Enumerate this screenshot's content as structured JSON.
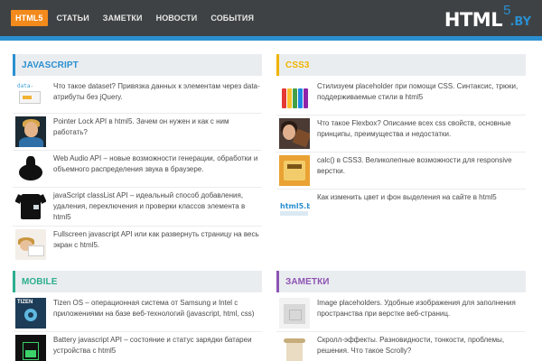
{
  "header": {
    "nav": [
      {
        "label": "HTML5",
        "active": true
      },
      {
        "label": "СТАТЬИ",
        "active": false
      },
      {
        "label": "ЗАМЕТКИ",
        "active": false
      },
      {
        "label": "НОВОСТИ",
        "active": false
      },
      {
        "label": "СОБЫТИЯ",
        "active": false
      }
    ],
    "logo": {
      "main": "HTML",
      "five": "5",
      "by": ".BY"
    }
  },
  "sections": {
    "javascript": {
      "title": "JAVASCRIPT",
      "accent": "#2a8fd0",
      "articles": [
        {
          "text": "Что такое dataset? Привязка данных к элементам через data-атрибуты без jQuery.",
          "thumb_label": "data-"
        },
        {
          "text": "Pointer Lock API в html5. Зачем он нужен и как с ним работать?"
        },
        {
          "text": "Web Audio API – новые возможности генерации, обработки и объемного распределения звука в браузере."
        },
        {
          "text": "javaScript classList API – идеальный способ добавления, удаления, переключения и проверки классов элемента в html5"
        },
        {
          "text": "Fullscreen javascript API или как развернуть страницу на весь экран с html5."
        }
      ]
    },
    "css3": {
      "title": "CSS3",
      "accent": "#f0b400",
      "articles": [
        {
          "text": "Стилизуем placeholder при помощи CSS. Синтаксис, трюки, поддерживаемые стили в html5"
        },
        {
          "text": "Что такое Flexbox? Описание всех css свойств, основные принципы, преимущества и недостатки."
        },
        {
          "text": "calc() в CSS3. Великолепные возможности для responsive верстки."
        },
        {
          "text": "Как изменить цвет и фон выделения на сайте в html5",
          "thumb_label": "html5.by"
        }
      ]
    },
    "mobile": {
      "title": "MOBILE",
      "accent": "#2cae8f",
      "articles": [
        {
          "text": "Tizen OS – операционная система от Samsung и Intel с приложениями на базе веб-технологий (javascript, html, css)",
          "thumb_label": "TIZEN"
        },
        {
          "text": "Battery javascript API – состояние и статус зарядки батареи устройства с html5"
        }
      ]
    },
    "notes": {
      "title": "ЗАМЕТКИ",
      "accent": "#8e54b4",
      "articles": [
        {
          "text": "Image placeholders. Удобные изображения для заполнения пространства при верстке веб-страниц."
        },
        {
          "text": "Скролл-эффекты. Разновидности, тонкости, проблемы, решения. Что такое Scrolly?"
        }
      ]
    }
  },
  "colors": {
    "topbar": "#3f4244",
    "stripe": "#2a8fd0",
    "nav_active": "#f28a1c"
  }
}
